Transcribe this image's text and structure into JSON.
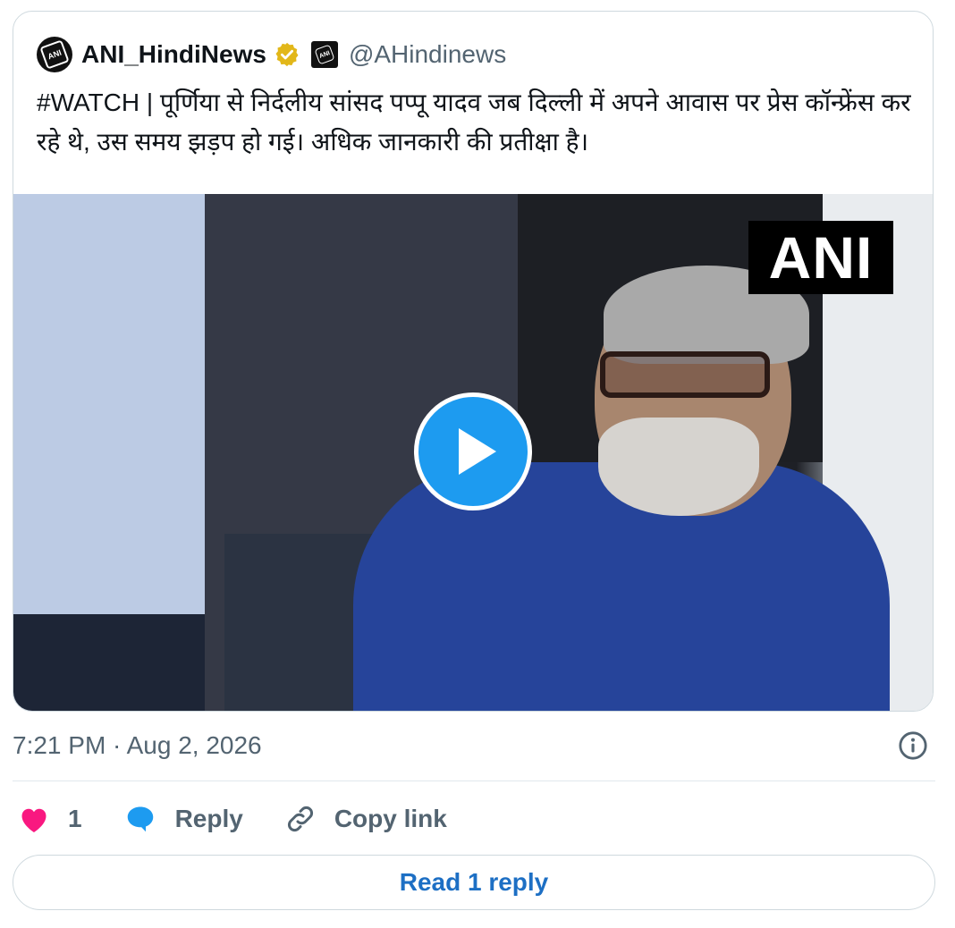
{
  "tweet": {
    "author": {
      "display_name": "ANI_HindiNews",
      "handle": "@AHindinews",
      "avatar_text": "ANI",
      "verified_badge_color": "#e2b719"
    },
    "text": "#WATCH | पूर्णिया से निर्दलीय सांसद पप्पू यादव जब दिल्ली में अपने आवास पर प्रेस कॉन्फ्रेंस कर रहे थे, उस समय झड़प हो गई। अधिक जानकारी की प्रतीक्षा है।",
    "media": {
      "watermark": "ANI",
      "play_icon": "play-icon"
    },
    "timestamp": "7:21 PM · Aug 2, 2026",
    "actions": {
      "like_count": "1",
      "reply_label": "Reply",
      "copy_link_label": "Copy link"
    },
    "read_replies_label": "Read 1 reply"
  },
  "colors": {
    "accent": "#1d9bf0",
    "like": "#f91880",
    "link": "#1d6fc4",
    "muted": "#536471"
  }
}
